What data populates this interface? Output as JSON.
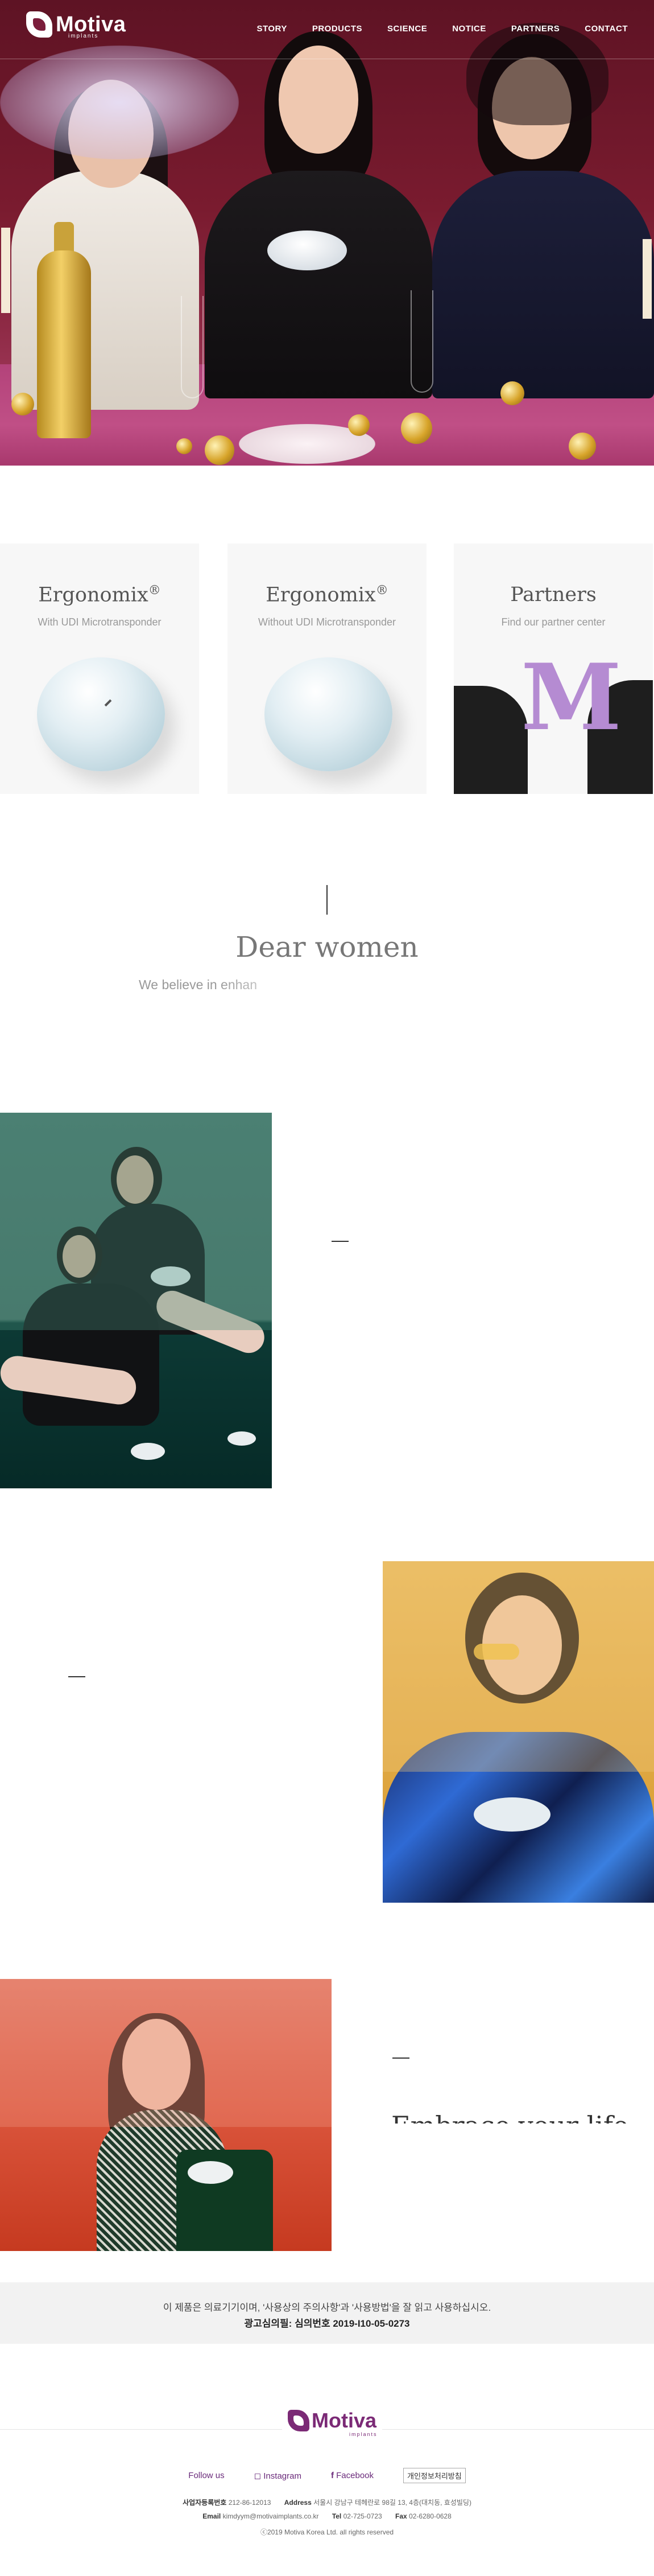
{
  "header": {
    "logo_text": "Motiva",
    "logo_sub": "implants",
    "menu": [
      "STORY",
      "PRODUCTS",
      "SCIENCE",
      "NOTICE",
      "PARTNERS",
      "CONTACT"
    ]
  },
  "products": [
    {
      "title": "Ergonomix",
      "mark": "®",
      "subtitle": "With UDI Microtransponder"
    },
    {
      "title": "Ergonomix",
      "mark": "®",
      "subtitle": "Without UDI Microtransponder"
    },
    {
      "title": "Partners",
      "mark": "",
      "subtitle": "Find our partner center",
      "letter": "M"
    }
  ],
  "intro": {
    "heading": "Dear women",
    "text": "We believe in enhan"
  },
  "story": {
    "embrace": "Embrace your life"
  },
  "notice": {
    "line1": "이 제품은 의료기기이며, '사용상의 주의사항'과 '사용방법'을 잘 읽고 사용하십시오.",
    "line2": "광고심의필: 심의번호 2019-I10-05-0273"
  },
  "footer": {
    "logo_text": "Motiva",
    "logo_sub": "implants",
    "follow": "Follow us",
    "instagram": "Instagram",
    "facebook": "Facebook",
    "privacy": "개인정보처리방침",
    "biz_label": "사업자등록번호",
    "biz_value": "212-86-12013",
    "addr_label": "Address",
    "addr_value": "서울시 강남구 테헤란로 98길 13, 4층(대치동, 효성빌딩)",
    "email_label": "Email",
    "email_value": "kimdyym@motivaimplants.co.kr",
    "tel_label": "Tel",
    "tel_value": "02-725-0723",
    "fax_label": "Fax",
    "fax_value": "02-6280-0628",
    "copyright": "ⓒ2019 Motiva Korea Ltd. all rights reserved"
  },
  "colors": {
    "hero_bg": "#7a1b2f",
    "brand_purple": "#7b2a76",
    "card_bg": "#f7f7f7"
  }
}
